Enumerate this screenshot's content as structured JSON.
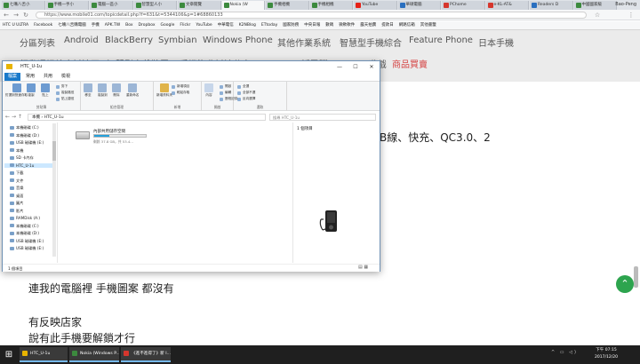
{
  "browser": {
    "tabs": [
      {
        "label": "七嘴八舌小",
        "color": "#3c8a3e"
      },
      {
        "label": "手機一手小",
        "color": "#3c8a3e"
      },
      {
        "label": "電腦一區小",
        "color": "#3c8a3e"
      },
      {
        "label": "智慧型人小",
        "color": "#3c8a3e"
      },
      {
        "label": "文章閱覽",
        "color": "#3c8a3e"
      },
      {
        "label": "Nokia (W",
        "color": "#3c8a3e"
      },
      {
        "label": "手機相機",
        "color": "#3c8a3e"
      },
      {
        "label": "手機相機",
        "color": "#3c8a3e"
      },
      {
        "label": "YouTube",
        "color": "#e62117"
      },
      {
        "label": "華碩電腦",
        "color": "#2a6fbf"
      },
      {
        "label": "PChome",
        "color": "#d6362d"
      },
      {
        "label": "e-KL-AT&",
        "color": "#d6362d"
      },
      {
        "label": "Readers D",
        "color": "#2a6fbf"
      },
      {
        "label": "中國國家級",
        "color": "#3c8a3e"
      }
    ],
    "profile": "Bao-Peng",
    "url": "https://www.mobile01.com/topicdetail.php?f=631&t=5344106&p=1#68860133",
    "bookmarks": [
      "HTC U ULTRA",
      "Facebook",
      "七嘴八舌購電腦",
      "手機",
      "APK.TW",
      "Box",
      "Dropbox",
      "Google",
      "Flickr",
      "YouTube",
      "中華電信",
      "K2NBlog",
      "ETtoday",
      "國家防務",
      "中央日報",
      "數碼",
      "微軟軟件",
      "露天拍賣",
      "提款日",
      "網路信箱",
      "其他書籤"
    ]
  },
  "site": {
    "nav_row1": [
      "分區列表",
      "Android",
      "BlackBerry",
      "Symbian",
      "Windows Phone",
      "其他作業系統",
      "智慧型手機綜合",
      "Feature Phone",
      "日本手機"
    ],
    "nav_row2": [
      "行動通訊綜合討論區",
      "智慧型穿戴裝置",
      "手機資費討論分享",
      "Android平板電腦",
      "Android遊戲",
      "商品買賣"
    ],
    "article_fragment": "B線、快充、QC3.0、2",
    "article_lines": [
      "連我的電腦裡 手機圖案 都沒有",
      "有反映店家",
      "說有此手機要解鎖才行"
    ]
  },
  "explorer": {
    "title": "HTC_U-1u",
    "ribbon_tabs": [
      "檔案",
      "常用",
      "共用",
      "檢視"
    ],
    "groups": [
      {
        "label": "剪貼簿",
        "big": [
          "釘選到快速存取",
          "複製",
          "貼上"
        ],
        "small": [
          "剪下",
          "複製路徑",
          "貼上捷徑"
        ]
      },
      {
        "label": "組合管理",
        "big": [
          "移至",
          "複製到",
          "刪除",
          "重新命名"
        ],
        "small": []
      },
      {
        "label": "新增",
        "big": [
          "新增資料夾"
        ],
        "small": [
          "新增項目",
          "輕鬆存取"
        ]
      },
      {
        "label": "開啟",
        "big": [
          "內容"
        ],
        "small": [
          "開啟",
          "編輯",
          "歷程記錄"
        ]
      },
      {
        "label": "選取",
        "big": [],
        "small": [
          "全選",
          "全部不選",
          "反向選擇"
        ]
      }
    ],
    "path": "本機 › HTC_U-1u",
    "search_placeholder": "搜尋 HTC_U-1u",
    "nav_items": [
      "本機磁碟 (C:)",
      "本機磁碟 (D:)",
      "USB 磁碟機 (E:)",
      "本機",
      "SD 卡內存",
      "HTC_U-1u",
      "下載",
      "文件",
      "音樂",
      "桌面",
      "圖片",
      "影片",
      "RAMDisk (A:)",
      "本機磁碟 (C:)",
      "本機磁碟 (D:)",
      "USB 磁碟機 (E:)",
      "USB 磁碟機 (E:)"
    ],
    "drive": {
      "name": "內部共用儲存空間",
      "size": "剩餘 37.8 GB，共 53.4...",
      "used_fraction": 0.29
    },
    "details_count": "1 個項目",
    "status": "1 個項目"
  },
  "taskbar": {
    "items": [
      {
        "label": "HTC_U-1u",
        "color": "#e8b400"
      },
      {
        "label": "Nokia (Windows P...",
        "color": "#3c8a3e"
      },
      {
        "label": "《進不進得了》新 I...",
        "color": "#d6362d"
      }
    ],
    "time": "下午 07:15",
    "date": "2017/12/20"
  }
}
